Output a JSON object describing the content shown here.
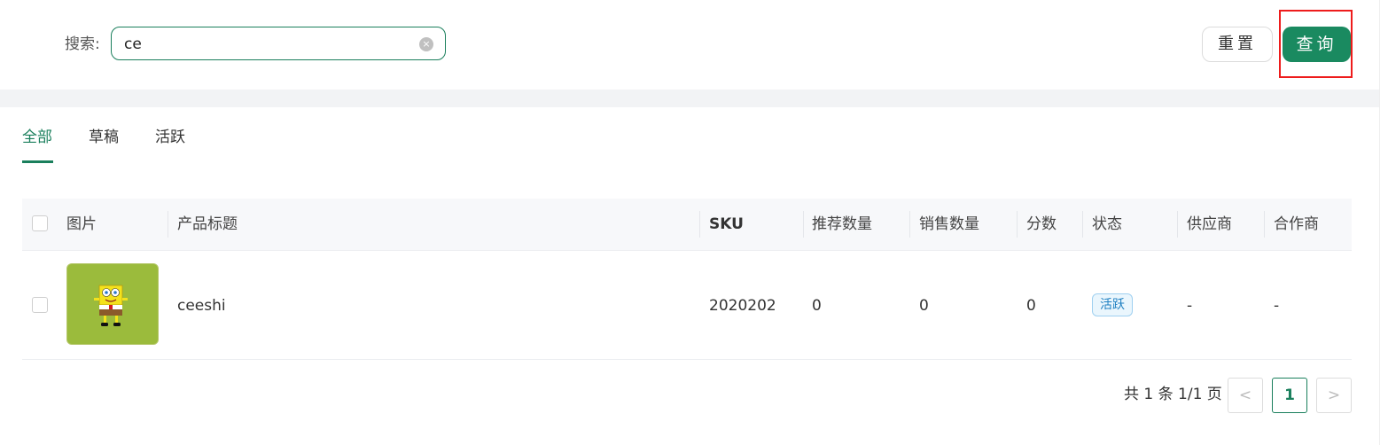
{
  "search": {
    "label": "搜索:",
    "value": "ce",
    "clear_symbol": "×"
  },
  "actions": {
    "reset_label": "重置",
    "query_label": "查询"
  },
  "tabs": [
    {
      "label": "全部",
      "active": true
    },
    {
      "label": "草稿",
      "active": false
    },
    {
      "label": "活跃",
      "active": false
    }
  ],
  "table": {
    "columns": [
      "图片",
      "产品标题",
      "SKU",
      "推荐数量",
      "销售数量",
      "分数",
      "状态",
      "供应商",
      "合作商"
    ],
    "rows": [
      {
        "image_icon": "spongebob-product-image",
        "title": "ceeshi",
        "sku": "2020202",
        "recommended_qty": "0",
        "sales_qty": "0",
        "score": "0",
        "status": "活跃",
        "supplier": "-",
        "partner": "-"
      }
    ]
  },
  "pagination": {
    "summary": "共 1 条 1/1 页",
    "prev_symbol": "<",
    "current_page": "1",
    "next_symbol": ">"
  },
  "colors": {
    "primary": "#1a8a60",
    "highlight": "#ee1c1c",
    "status_active_text": "#1d7fc1",
    "thumb_bg": "#9bbb3c"
  }
}
